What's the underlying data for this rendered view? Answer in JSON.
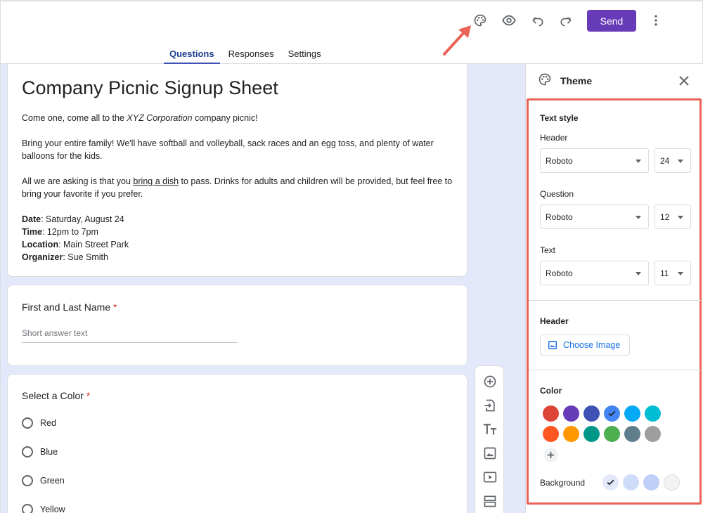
{
  "topbar": {
    "send_label": "Send",
    "tabs": [
      "Questions",
      "Responses",
      "Settings"
    ],
    "icons": [
      "palette-icon",
      "eye-icon",
      "undo-icon",
      "redo-icon",
      "more-vert-icon"
    ],
    "annotation_color": "#ea6357"
  },
  "form": {
    "title": "Company Picnic Signup Sheet",
    "desc_line1_pre": "Come one, come all to the ",
    "desc_line1_em": "XYZ Corporation",
    "desc_line1_post": " company picnic!",
    "desc_line2": "Bring your entire family! We'll have softball and volleyball, sack races and an egg toss, and plenty of water balloons for the kids.",
    "desc_line3_pre": "All we are asking is that you ",
    "desc_line3_link": "bring a dish",
    "desc_line3_post": " to pass. Drinks for adults and children will be provided, but feel free to bring your favorite if you prefer.",
    "details": [
      {
        "label": "Date",
        "value": ": Saturday, August 24"
      },
      {
        "label": "Time",
        "value": ": 12pm to 7pm"
      },
      {
        "label": "Location",
        "value": ": Main Street Park"
      },
      {
        "label": "Organizer",
        "value": ": Sue Smith"
      }
    ]
  },
  "question1": {
    "title": "First and Last Name",
    "required_mark": "*",
    "placeholder": "Short answer text"
  },
  "question2": {
    "title": "Select a Color",
    "required_mark": "*",
    "options": [
      "Red",
      "Blue",
      "Green",
      "Yellow"
    ]
  },
  "theme_panel": {
    "title": "Theme",
    "text_style_label": "Text style",
    "header_label": "Header",
    "header_font": "Roboto",
    "header_size": "24",
    "question_label": "Question",
    "question_font": "Roboto",
    "question_size": "12",
    "text_label": "Text",
    "text_font": "Roboto",
    "text_size": "11",
    "header_section_label": "Header",
    "choose_image_label": "Choose Image",
    "color_label": "Color",
    "colors": [
      "#db4437",
      "#673ab7",
      "#3f51b5",
      "#4285f4",
      "#03a9f4",
      "#00bcd4",
      "#ff5722",
      "#ff9800",
      "#009688",
      "#4caf50",
      "#607d8b",
      "#9e9e9e"
    ],
    "selected_color": "#4285f4",
    "background_label": "Background",
    "backgrounds": [
      "#e3e8fb",
      "#cfdcf9",
      "#bed0f8",
      "#f3f3f3"
    ],
    "selected_background": "#e3e8fb"
  }
}
